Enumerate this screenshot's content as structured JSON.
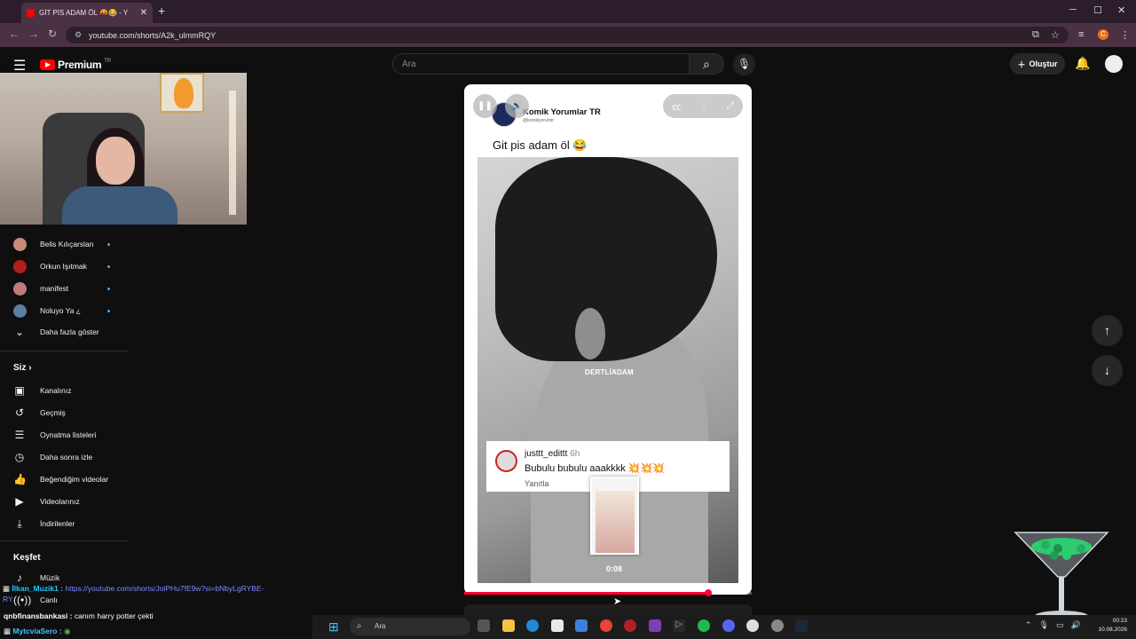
{
  "browser": {
    "tab_title": "GİT PİS ADAM ÖL 😂😂 - YouTube",
    "tab_title_visible": "GİT PİS ADAM ÖL 🤬😂 - Y",
    "url": "youtube.com/shorts/A2k_ulmmRQY",
    "new_tab": "+",
    "minimize": "─",
    "maximize": "☐",
    "close": "✕",
    "profile_initial": "C"
  },
  "header": {
    "logo_text": "Premium",
    "logo_region": "TR",
    "search_placeholder": "Ara",
    "create_label": "Oluştur"
  },
  "sidebar": {
    "subscriptions": [
      {
        "label": "Belis Kılıçarslan",
        "color": "#c98a7a"
      },
      {
        "label": "Orkun Işıtmak",
        "color": "#b02020"
      },
      {
        "label": "manifest",
        "color": "#c07a7a"
      },
      {
        "label": "Noluyo Ya ¿",
        "color": "#5a7fa0"
      }
    ],
    "show_more": "Daha fazla göster",
    "you_heading": "Siz",
    "you_items": [
      {
        "label": "Kanalınız",
        "icon": "channel-icon"
      },
      {
        "label": "Geçmiş",
        "icon": "history-icon"
      },
      {
        "label": "Oynatma listeleri",
        "icon": "playlist-icon"
      },
      {
        "label": "Daha sonra izle",
        "icon": "clock-icon"
      },
      {
        "label": "Beğendiğim videolar",
        "icon": "like-icon"
      },
      {
        "label": "Videolarınız",
        "icon": "video-icon"
      },
      {
        "label": "İndirilenler",
        "icon": "download-icon"
      }
    ],
    "explore_heading": "Keşfet",
    "explore_items": [
      {
        "label": "Müzik",
        "icon": "music-icon"
      },
      {
        "label": "Canlı",
        "icon": "live-icon"
      }
    ]
  },
  "short": {
    "channel_name": "Komik Yorumlar TR",
    "channel_handle": "@komikyorumtr",
    "post_text": "Git pis adam öl 😂",
    "watermark": "DERTLİADAM",
    "comment_user": "justtt_edittt",
    "comment_time": "6h",
    "comment_text": "Bubulu bubulu     aaakkkk 💥💥💥",
    "comment_reply": "Yanıtla",
    "timestamp": "0:08",
    "progress": 0.85
  },
  "chat": [
    {
      "user": "İlkan_Muzik1 :",
      "message": " https://youtube.com/shorts/JolPHu7fE9w?si=bNbyLgRYBE-"
    },
    {
      "user": "qnbfinansbankasi :",
      "message": " canım harry potter çekti"
    },
    {
      "user": "MytcviaSero :",
      "message": ""
    }
  ],
  "taskbar": {
    "search_placeholder": "Ara",
    "time": "00:23",
    "date": "10.08.2026"
  }
}
